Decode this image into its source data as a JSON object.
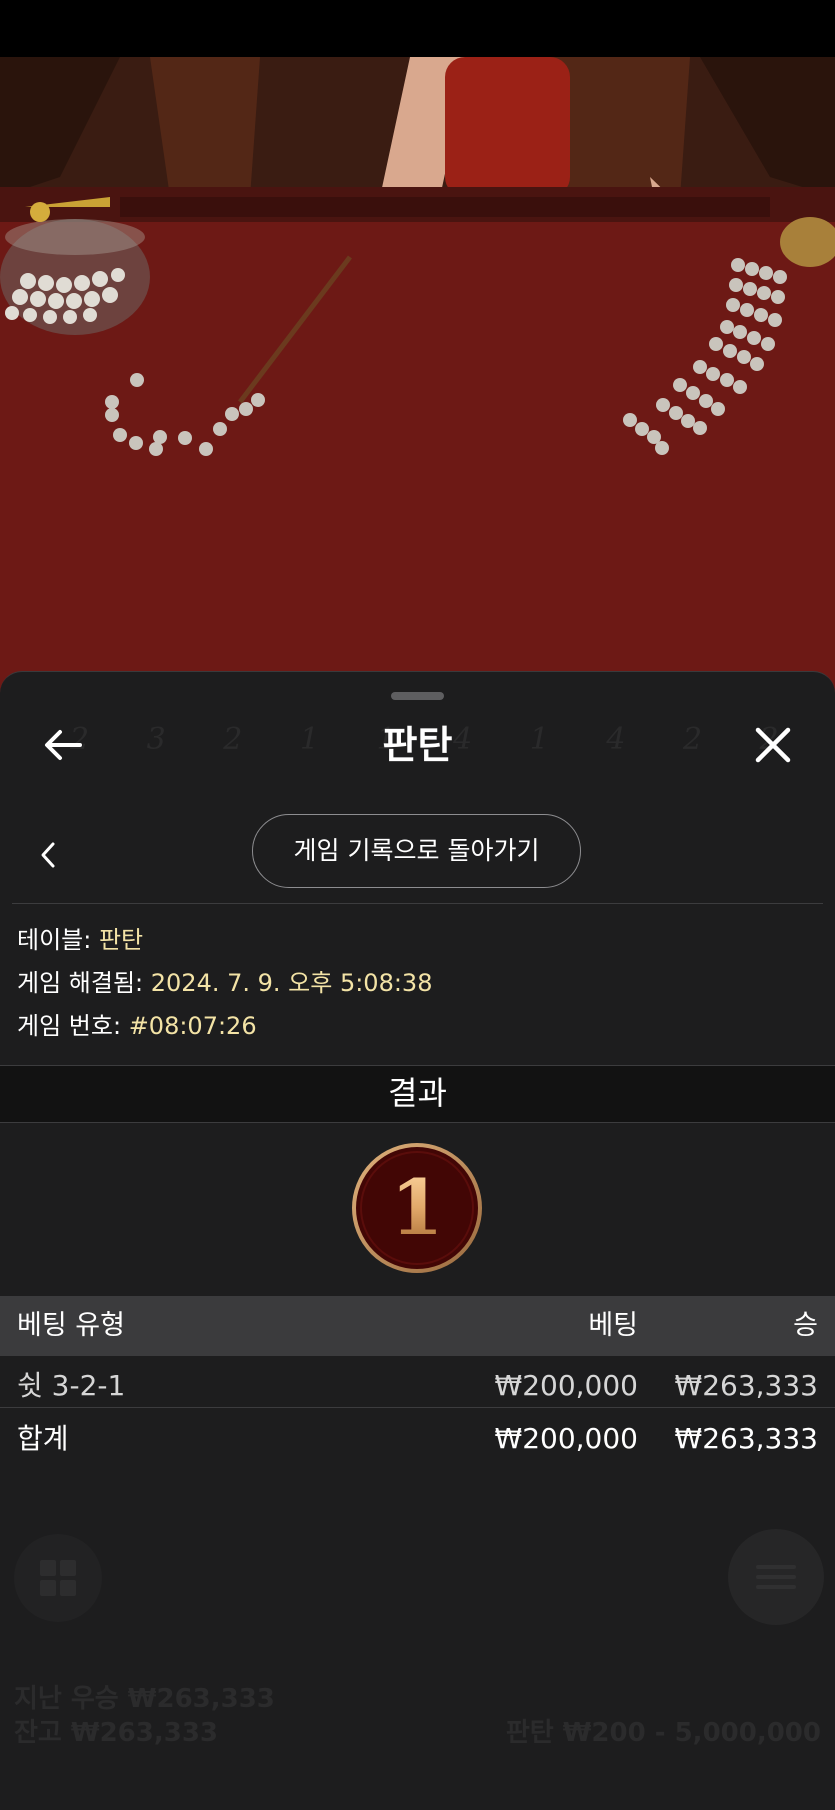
{
  "header": {
    "title": "판탄",
    "back_icon": "arrow-left-icon",
    "close_icon": "close-icon"
  },
  "history": {
    "back_icon": "chevron-left-icon",
    "button_label": "게임 기록으로 돌아가기"
  },
  "details": {
    "table_label": "테이블:",
    "table_value": "판탄",
    "resolved_label": "게임 해결됨:",
    "resolved_value": "2024. 7. 9. 오후 5:08:38",
    "game_no_label": "게임 번호:",
    "game_no_value": "#08:07:26"
  },
  "result": {
    "heading": "결과",
    "value": "1"
  },
  "bets_table": {
    "columns": [
      "베팅 유형",
      "베팅",
      "승"
    ],
    "rows": [
      {
        "type": "쉿 3-2-1",
        "bet": "₩200,000",
        "win": "₩263,333"
      }
    ],
    "total": {
      "type": "합계",
      "bet": "₩200,000",
      "win": "₩263,333"
    }
  },
  "background": {
    "last_win_label": "지난 우승",
    "last_win_value": "₩263,333",
    "balance_label": "잔고",
    "balance_value": "₩263,333",
    "table_label": "판탄",
    "limits": "₩200 - 5,000,000"
  },
  "colors": {
    "sheet_bg": "#1d1d1e",
    "highlight_text": "#f3e3a6",
    "table_header_bg": "#3b3b3d",
    "felt": "#6e1915",
    "coin_gold": "#c8935a"
  }
}
